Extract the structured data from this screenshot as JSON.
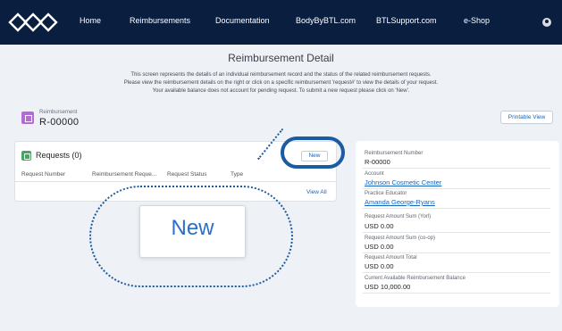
{
  "nav": {
    "items": [
      "Home",
      "Reimbursements",
      "Documentation",
      "BodyByBTL.com",
      "BTLSupport.com",
      "e-Shop"
    ]
  },
  "intro": {
    "title": "Reimbursement Detail",
    "lines": [
      "This screen represents the details of an individual reimbursement record and the status of the related reimbursement requests.",
      "Please view the reimbursement details on the right or click on a specific reimbursement 'request#' to view the details of your request.",
      "Your available balance does not account for pending request.  To submit a new request please click on 'New'."
    ]
  },
  "record": {
    "label": "Reimbursement",
    "number": "R-00000",
    "printable_label": "Printable View"
  },
  "requests": {
    "title": "Requests (0)",
    "new_label": "New",
    "columns": [
      "Request Number",
      "Reimbursement Reque...",
      "Request Status",
      "Type"
    ],
    "view_all_label": "View All"
  },
  "callout": {
    "zoom_label": "New"
  },
  "details": {
    "fields": [
      {
        "label": "Reimbursement Number",
        "value": "R-00000"
      },
      {
        "label": "Account",
        "value": "Johnson Cosmetic Center"
      },
      {
        "label": "Practice Educator",
        "value": "Amanda George-Ryans"
      },
      {
        "label": "Request Amount Sum (Yorl)",
        "value": "USD 0.00"
      },
      {
        "label": "Request Amount Sum (co-op)",
        "value": "USD 0.00"
      },
      {
        "label": "Request Amount Total",
        "value": "USD 0.00"
      },
      {
        "label": "Current Available Reimbursement Balance",
        "value": "USD 10,000.00"
      }
    ]
  },
  "colors": {
    "navbar": "#0a1f3f",
    "link": "#1565c0",
    "highlight_ring": "#1a5ba4",
    "page_background": "#eef1f5"
  }
}
